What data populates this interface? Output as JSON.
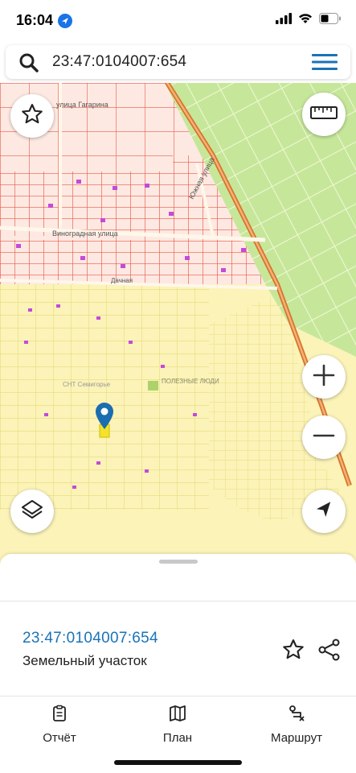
{
  "status": {
    "time": "16:04"
  },
  "search": {
    "query": "23:47:0104007:654"
  },
  "map": {
    "streets": [
      "улица Гагарина",
      "Виноградная улица",
      "Южная улица",
      "Дачная"
    ],
    "labels": [
      "СНТ Семигорье"
    ],
    "watermark": "ПОЛЕЗНЫЕ ЛЮДИ"
  },
  "parcel": {
    "cadastral_number": "23:47:0104007:654",
    "type": "Земельный участок"
  },
  "tabs": [
    {
      "label": "Отчёт",
      "icon": "report-icon"
    },
    {
      "label": "План",
      "icon": "map-plan-icon"
    },
    {
      "label": "Маршрут",
      "icon": "route-icon"
    }
  ],
  "colors": {
    "accent": "#1a73b8",
    "parcel_fill": "#fbf3b8",
    "parcel_border": "#e8dc7a",
    "cadastre_red": "#e85a4a",
    "park_green": "#b8e08a"
  }
}
